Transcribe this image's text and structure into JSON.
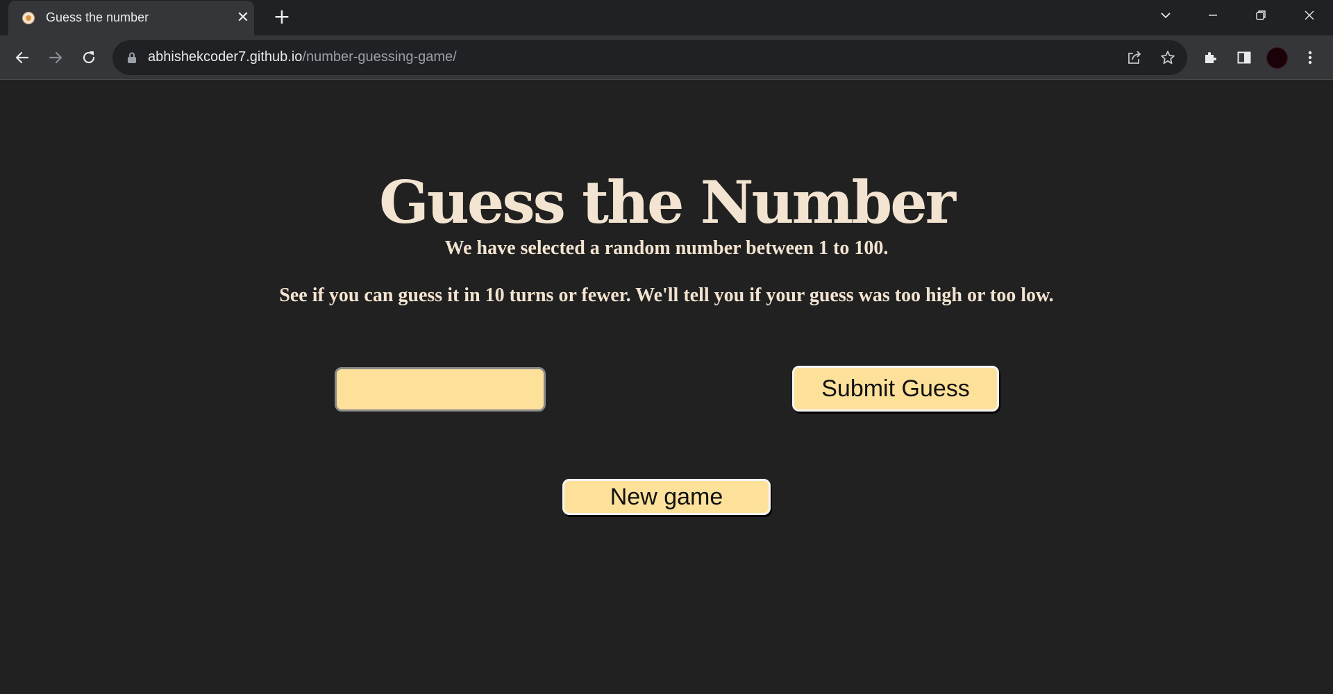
{
  "browser": {
    "tab": {
      "title": "Guess the number",
      "favicon": "page-favicon"
    },
    "url": {
      "host": "abhishekcoder7.github.io",
      "path": "/number-guessing-game/"
    },
    "icons": {
      "back": "back-arrow-icon",
      "forward": "forward-arrow-icon",
      "reload": "reload-icon",
      "lock": "lock-icon",
      "share": "share-icon",
      "bookmark": "star-icon",
      "extensions": "puzzle-icon",
      "side_panel": "side-panel-icon",
      "menu": "kebab-menu-icon"
    }
  },
  "page": {
    "title": "Guess the Number",
    "intro_line_1": "We have selected a random number between 1 to 100.",
    "intro_line_2": "See if you can guess it in 10 turns or fewer. We'll tell you if your guess was too high or too low.",
    "guess_field": {
      "value": "",
      "placeholder": ""
    },
    "submit_label": "Submit Guess",
    "new_game_label": "New game"
  },
  "colors": {
    "page_background": "#212121",
    "heading_text": "#f3e4d1",
    "accent": "#fde09a"
  }
}
